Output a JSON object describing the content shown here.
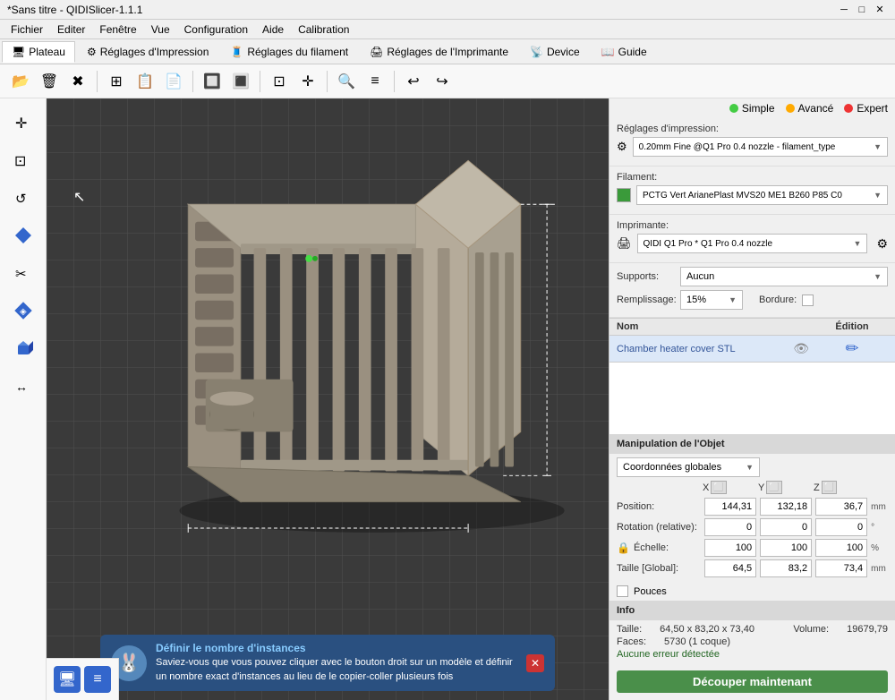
{
  "titlebar": {
    "title": "*Sans titre - QIDISlicer-1.1.1",
    "minimize": "─",
    "maximize": "□",
    "close": "✕"
  },
  "menubar": {
    "items": [
      "Fichier",
      "Editer",
      "Fenêtre",
      "Vue",
      "Configuration",
      "Aide",
      "Calibration"
    ]
  },
  "tabs": [
    {
      "label": "Plateau",
      "icon": "🖥",
      "active": true
    },
    {
      "label": "Réglages d'Impression",
      "icon": "⚙"
    },
    {
      "label": "Réglages du filament",
      "icon": "🧵"
    },
    {
      "label": "Réglages de l'Imprimante",
      "icon": "🖨"
    },
    {
      "label": "Device",
      "icon": "📡"
    },
    {
      "label": "Guide",
      "icon": "📖"
    }
  ],
  "toolbar": {
    "buttons": [
      "📂",
      "🗑",
      "✖",
      "⊞",
      "📋",
      "📄",
      "🔲",
      "🔳",
      "⊡",
      "✛",
      "🔍",
      "≡",
      "↩",
      "↪"
    ]
  },
  "left_tools": [
    "✛",
    "⊡",
    "↺",
    "◆",
    "✂",
    "◈",
    "🎲",
    "↔"
  ],
  "right_panel": {
    "print_settings_label": "Réglages d'impression:",
    "print_settings_value": "0.20mm Fine @Q1 Pro 0.4 nozzle - filament_type",
    "filament_label": "Filament:",
    "filament_color": "#3a9a3a",
    "filament_value": "PCTG Vert ArianePlast MVS20 ME1 B260 P85 C0",
    "printer_label": "Imprimante:",
    "printer_value": "QIDI Q1 Pro * Q1 Pro 0.4 nozzle",
    "supports_label": "Supports:",
    "supports_value": "Aucun",
    "remplissage_label": "Remplissage:",
    "remplissage_value": "15%",
    "bordure_label": "Bordure:",
    "object_table": {
      "col_nom": "Nom",
      "col_edition": "Édition",
      "rows": [
        {
          "nom": "Chamber heater cover STL",
          "visible": true
        }
      ]
    },
    "manipulation_header": "Manipulation de l'Objet",
    "coord_system": "Coordonnées globales",
    "x_label": "X ⬜",
    "y_label": "Y ⬜",
    "z_label": "Z ⬜",
    "position_label": "Position:",
    "position_x": "144,31",
    "position_y": "132,18",
    "position_z": "36,7",
    "position_unit": "mm",
    "rotation_label": "Rotation (relative):",
    "rotation_x": "0",
    "rotation_y": "0",
    "rotation_z": "0",
    "rotation_unit": "°",
    "scale_label": "Échelle:",
    "scale_x": "100",
    "scale_y": "100",
    "scale_z": "100",
    "scale_unit": "%",
    "size_label": "Taille [Global]:",
    "size_x": "64,5",
    "size_y": "83,2",
    "size_z": "73,4",
    "size_unit": "mm",
    "pouces_label": "Pouces",
    "info_header": "Info",
    "info_taille_label": "Taille:",
    "info_taille_value": "64,50 x 83,20 x 73,40",
    "info_volume_label": "Volume:",
    "info_volume_value": "19679,79",
    "info_faces_label": "Faces:",
    "info_faces_value": "5730 (1 coque)",
    "info_error": "Aucune erreur détectée",
    "decoupe_label": "Découper maintenant"
  },
  "status_bar": {
    "simple_label": "Simple",
    "avance_label": "Avancé",
    "expert_label": "Expert"
  },
  "notification": {
    "title": "Définir le nombre d'instances",
    "body": "Saviez-vous que vous pouvez cliquer avec le bouton droit sur un modèle et définir un nombre exact d'instances au lieu de le copier-coller plusieurs fois"
  },
  "bottom_icons": [
    "🖥",
    "≡"
  ]
}
